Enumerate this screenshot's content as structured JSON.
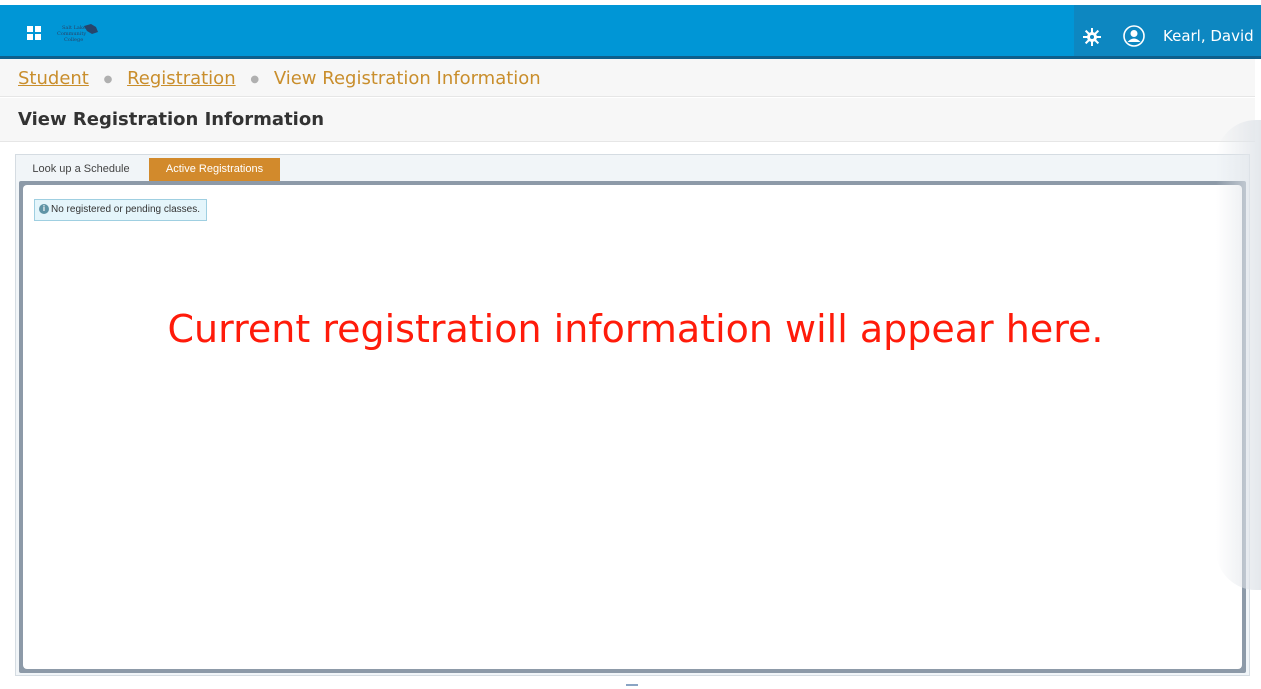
{
  "header": {
    "apps_icon": "apps-grid-icon",
    "logo_text": "Salt Lake Community College",
    "settings_icon": "gear-icon",
    "user_icon": "user-avatar-icon",
    "user_name": "Kearl, David",
    "bar_color": "#0096d6",
    "accent_color": "#0d87c1"
  },
  "breadcrumb": {
    "items": [
      {
        "label": "Student",
        "link": true
      },
      {
        "label": "Registration",
        "link": true
      },
      {
        "label": "View Registration Information",
        "link": false
      }
    ]
  },
  "page": {
    "title": "View Registration Information"
  },
  "tabs": [
    {
      "label": "Look up a Schedule",
      "active": false
    },
    {
      "label": "Active Registrations",
      "active": true
    }
  ],
  "notice": {
    "icon": "info-icon",
    "text": "No registered or pending classes."
  },
  "annotation": {
    "text": "Current registration information will appear here.",
    "color": "#ff1b0a"
  }
}
